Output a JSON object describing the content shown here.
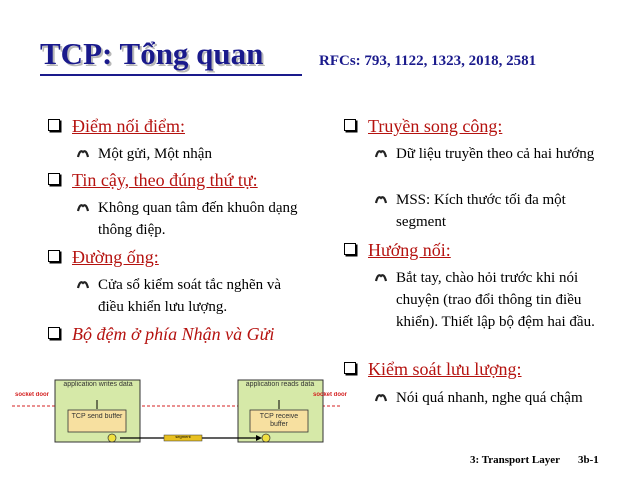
{
  "title": "TCP: Tổng quan",
  "rfcs": "RFCs: 793, 1122, 1323, 2018, 2581",
  "left_bullets": [
    {
      "label": "Điểm nối điểm:",
      "subs": [
        "Một gửi, Một nhận"
      ]
    },
    {
      "label": "Tin cậy, theo đúng thứ tự:",
      "subs": [
        "Không quan tâm đến khuôn dạng thông điệp."
      ]
    },
    {
      "label": "Đường ống:",
      "subs": [
        "Cửa sổ kiểm soát tắc nghẽn và điều khiển lưu lượng."
      ]
    },
    {
      "label": "Bộ đệm ở phía Nhận và Gửi",
      "subs": []
    }
  ],
  "right_bullets": [
    {
      "label": "Truyền song công:",
      "subs": [
        "Dữ liệu truyền theo cả hai hướng",
        "MSS: Kích thước tối đa một segment"
      ]
    },
    {
      "label": "Hướng nối:",
      "subs": [
        "Bắt tay, chào hỏi trước khi nói chuyện (trao đổi thông tin điều khiển). Thiết lập bộ đệm hai đầu."
      ]
    },
    {
      "label": "Kiểm soát lưu lượng:",
      "subs": [
        "Nói quá nhanh, nghe quá chậm"
      ]
    }
  ],
  "diagram": {
    "left_app": "application writes data",
    "left_buffer": "TCP send buffer",
    "right_app": "application reads data",
    "right_buffer": "TCP receive buffer",
    "socket_door": "socket door",
    "segment": "segment"
  },
  "footer": {
    "section": "3: Transport Layer",
    "page": "3b-1"
  },
  "colors": {
    "title": "#1a1a8c",
    "bullet_text": "#b5120f",
    "box_fill": "#d6e9a8"
  }
}
